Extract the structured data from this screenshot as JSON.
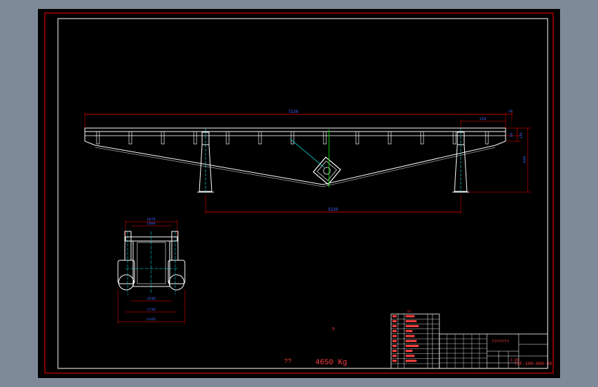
{
  "drawing": {
    "background": "#7f8a99",
    "sheet_color": "#000000",
    "colors": {
      "frame": "#ff0000",
      "outline": "#ffffff",
      "dimension": "#0000ff",
      "center": "#00cc00",
      "cyan": "#00ffff",
      "title_text": "#ff4040"
    }
  },
  "front_view": {
    "dim_total": "7130",
    "dim_right_top": "150",
    "dim_far_right": "20",
    "dim_support_span": "5230",
    "dim_height_a": "50",
    "dim_height_b": "120",
    "dim_height_total": "650"
  },
  "side_view": {
    "dim_top_outer": "1670",
    "dim_top_inner": "1500",
    "dim_bottom_a": "1530",
    "dim_bottom_b": "1730",
    "dim_bottom_c": "2165"
  },
  "notes": {
    "center_mark": "?",
    "weight_label": "??",
    "weight_value": "4650 Kg"
  },
  "title_block": {
    "parts_header": "??",
    "description": "???????",
    "drawing_number": "TSF-100-000-00",
    "scale_label": "1:20"
  }
}
